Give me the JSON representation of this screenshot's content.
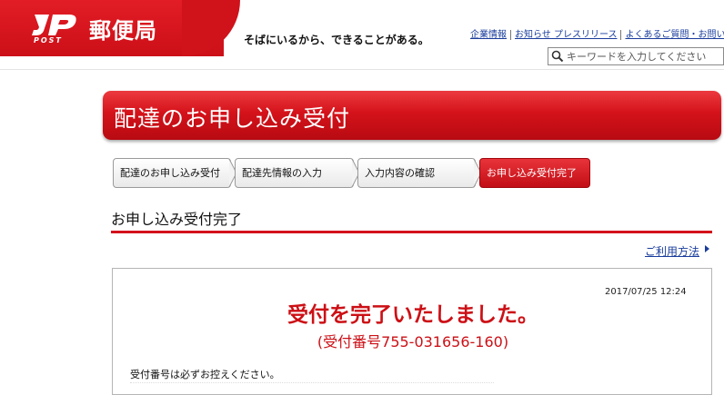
{
  "header": {
    "brand_post": "POST",
    "brand_name": "郵便局",
    "tagline": "そばにいるから、できることがある。",
    "nav_links": [
      "企業情報",
      "お知らせ プレスリリース",
      "よくあるご質問・お問い合わ"
    ],
    "search": {
      "placeholder": "キーワードを入力してください"
    },
    "colors": {
      "brand_red": "#d4121a",
      "link_blue": "#1a3d9c"
    }
  },
  "banner": {
    "title": "配達のお申し込み受付"
  },
  "steps": [
    {
      "label": "配達のお申し込み受付",
      "active": false
    },
    {
      "label": "配達先情報の入力",
      "active": false
    },
    {
      "label": "入力内容の確認",
      "active": false
    },
    {
      "label": "お申し込み受付完了",
      "active": true
    }
  ],
  "section": {
    "title": "お申し込み受付完了",
    "help_link": "ご利用方法"
  },
  "result": {
    "timestamp": "2017/07/25 12:24",
    "heading": "受付を完了いたしました。",
    "receipt_number": "(受付番号755-031656-160)",
    "note": "受付番号は必ずお控えください。"
  }
}
